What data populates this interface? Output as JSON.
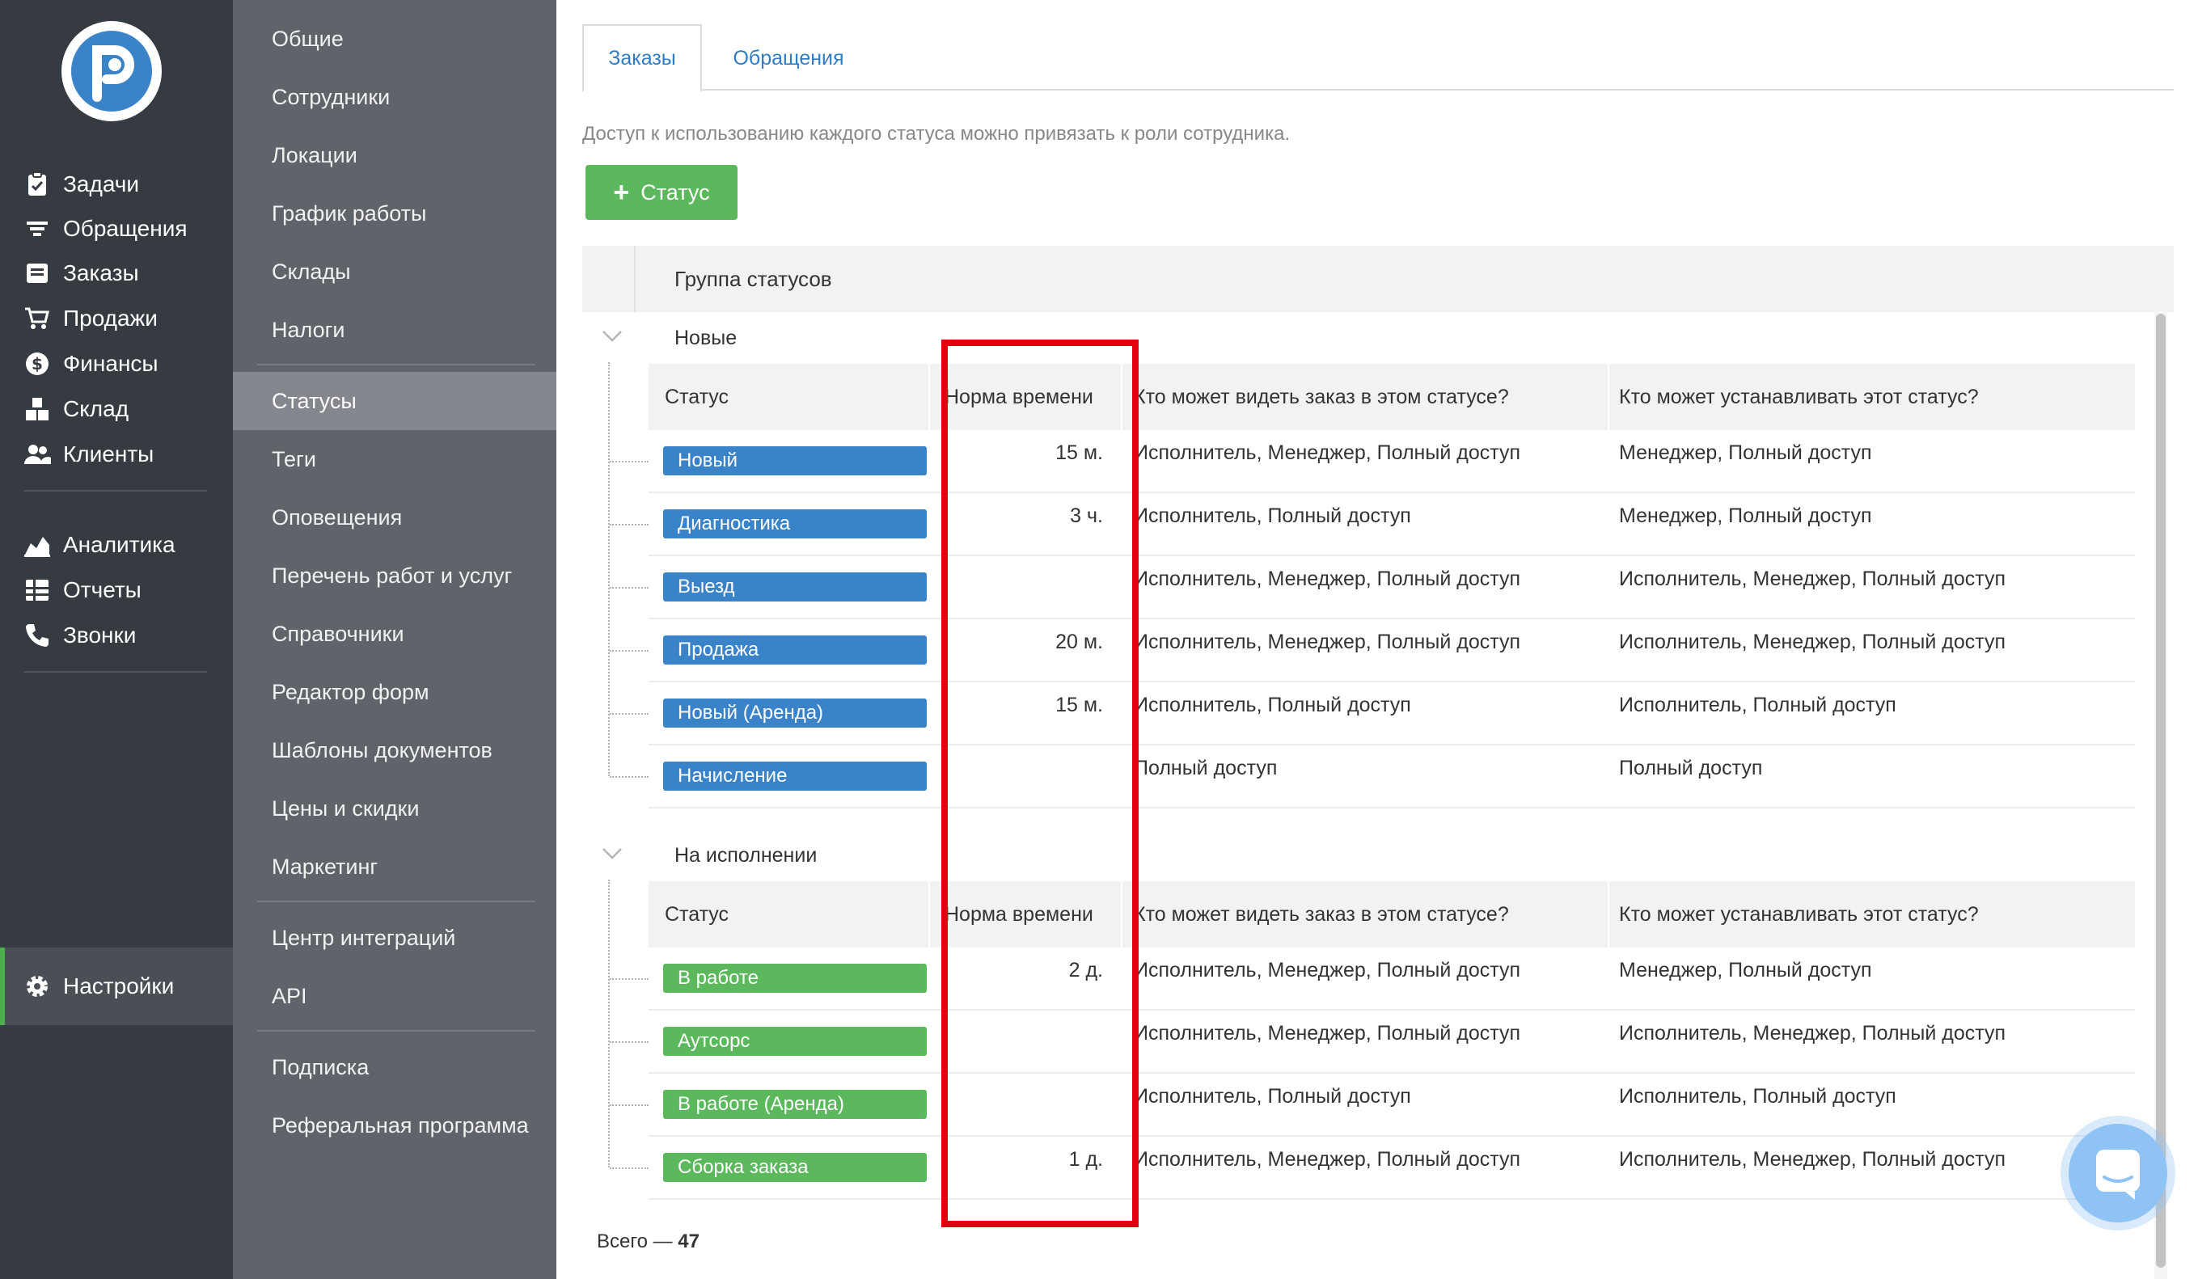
{
  "nav": {
    "items": [
      {
        "label": "Задачи",
        "icon": "clipboard-icon"
      },
      {
        "label": "Обращения",
        "icon": "funnel-icon"
      },
      {
        "label": "Заказы",
        "icon": "order-icon"
      },
      {
        "label": "Продажи",
        "icon": "cart-icon"
      },
      {
        "label": "Финансы",
        "icon": "dollar-icon"
      },
      {
        "label": "Склад",
        "icon": "boxes-icon"
      },
      {
        "label": "Клиенты",
        "icon": "users-icon"
      },
      {
        "label": "Аналитика",
        "icon": "chart-area-icon"
      },
      {
        "label": "Отчеты",
        "icon": "grid-icon"
      },
      {
        "label": "Звонки",
        "icon": "phone-icon"
      },
      {
        "label": "Настройки",
        "icon": "gear-icon",
        "active": true
      }
    ]
  },
  "submenu": {
    "items": [
      "Общие",
      "Сотрудники",
      "Локации",
      "График работы",
      "Склады",
      "Налоги",
      "Статусы",
      "Теги",
      "Оповещения",
      "Перечень работ и услуг",
      "Справочники",
      "Редактор форм",
      "Шаблоны документов",
      "Цены и скидки",
      "Маркетинг",
      "Центр интеграций",
      "API",
      "Подписка",
      "Реферальная программа"
    ],
    "active": "Статусы"
  },
  "tabs": [
    {
      "label": "Заказы",
      "active": true
    },
    {
      "label": "Обращения",
      "active": false
    }
  ],
  "description": "Доступ к использованию каждого статуса можно привязать к роли сотрудника.",
  "add_button": {
    "plus": "+",
    "label": "Статус"
  },
  "group_header": "Группа статусов",
  "columns": {
    "status": "Статус",
    "norm": "Норма времени",
    "see": "Кто может видеть заказ в этом статусе?",
    "set": "Кто может устанавливать этот статус?"
  },
  "groups": [
    {
      "title": "Новые",
      "color": "#3b83c9",
      "rows": [
        {
          "status": "Новый",
          "norm": "15 м.",
          "see": "Исполнитель,  Менеджер,  Полный доступ",
          "set": "Менеджер,  Полный доступ"
        },
        {
          "status": "Диагностика",
          "norm": "3 ч.",
          "see": "Исполнитель,  Полный доступ",
          "set": "Менеджер,  Полный доступ"
        },
        {
          "status": "Выезд",
          "norm": "",
          "see": "Исполнитель,  Менеджер,  Полный доступ",
          "set": "Исполнитель,  Менеджер,  Полный доступ"
        },
        {
          "status": "Продажа",
          "norm": "20 м.",
          "see": "Исполнитель,  Менеджер,  Полный доступ",
          "set": "Исполнитель,  Менеджер,  Полный доступ"
        },
        {
          "status": "Новый (Аренда)",
          "norm": "15 м.",
          "see": "Исполнитель,  Полный доступ",
          "set": "Исполнитель,  Полный доступ"
        },
        {
          "status": "Начисление",
          "norm": "",
          "see": "Полный доступ",
          "set": "Полный доступ"
        }
      ]
    },
    {
      "title": "На исполнении",
      "color": "#5cb85c",
      "rows": [
        {
          "status": "В работе",
          "norm": "2 д.",
          "see": "Исполнитель,  Менеджер,  Полный доступ",
          "set": "Менеджер,  Полный доступ"
        },
        {
          "status": "Аутсорс",
          "norm": "",
          "see": "Исполнитель,  Менеджер,  Полный доступ",
          "set": "Исполнитель,  Менеджер,  Полный доступ"
        },
        {
          "status": "В работе (Аренда)",
          "norm": "",
          "see": "Исполнитель,  Полный доступ",
          "set": "Исполнитель,  Полный доступ"
        },
        {
          "status": "Сборка заказа",
          "norm": "1 д.",
          "see": "Исполнитель,  Менеджер,  Полный доступ",
          "set": "Исполнитель,  Менеджер,  Полный доступ"
        }
      ]
    }
  ],
  "total": {
    "label": "Всего —",
    "count": "47"
  },
  "colors": {
    "accent_green": "#5cb85c",
    "accent_blue": "#3b83c9",
    "highlight_red": "#e3000f",
    "nav_bg": "#363b42",
    "submenu_bg": "#5f636a"
  }
}
